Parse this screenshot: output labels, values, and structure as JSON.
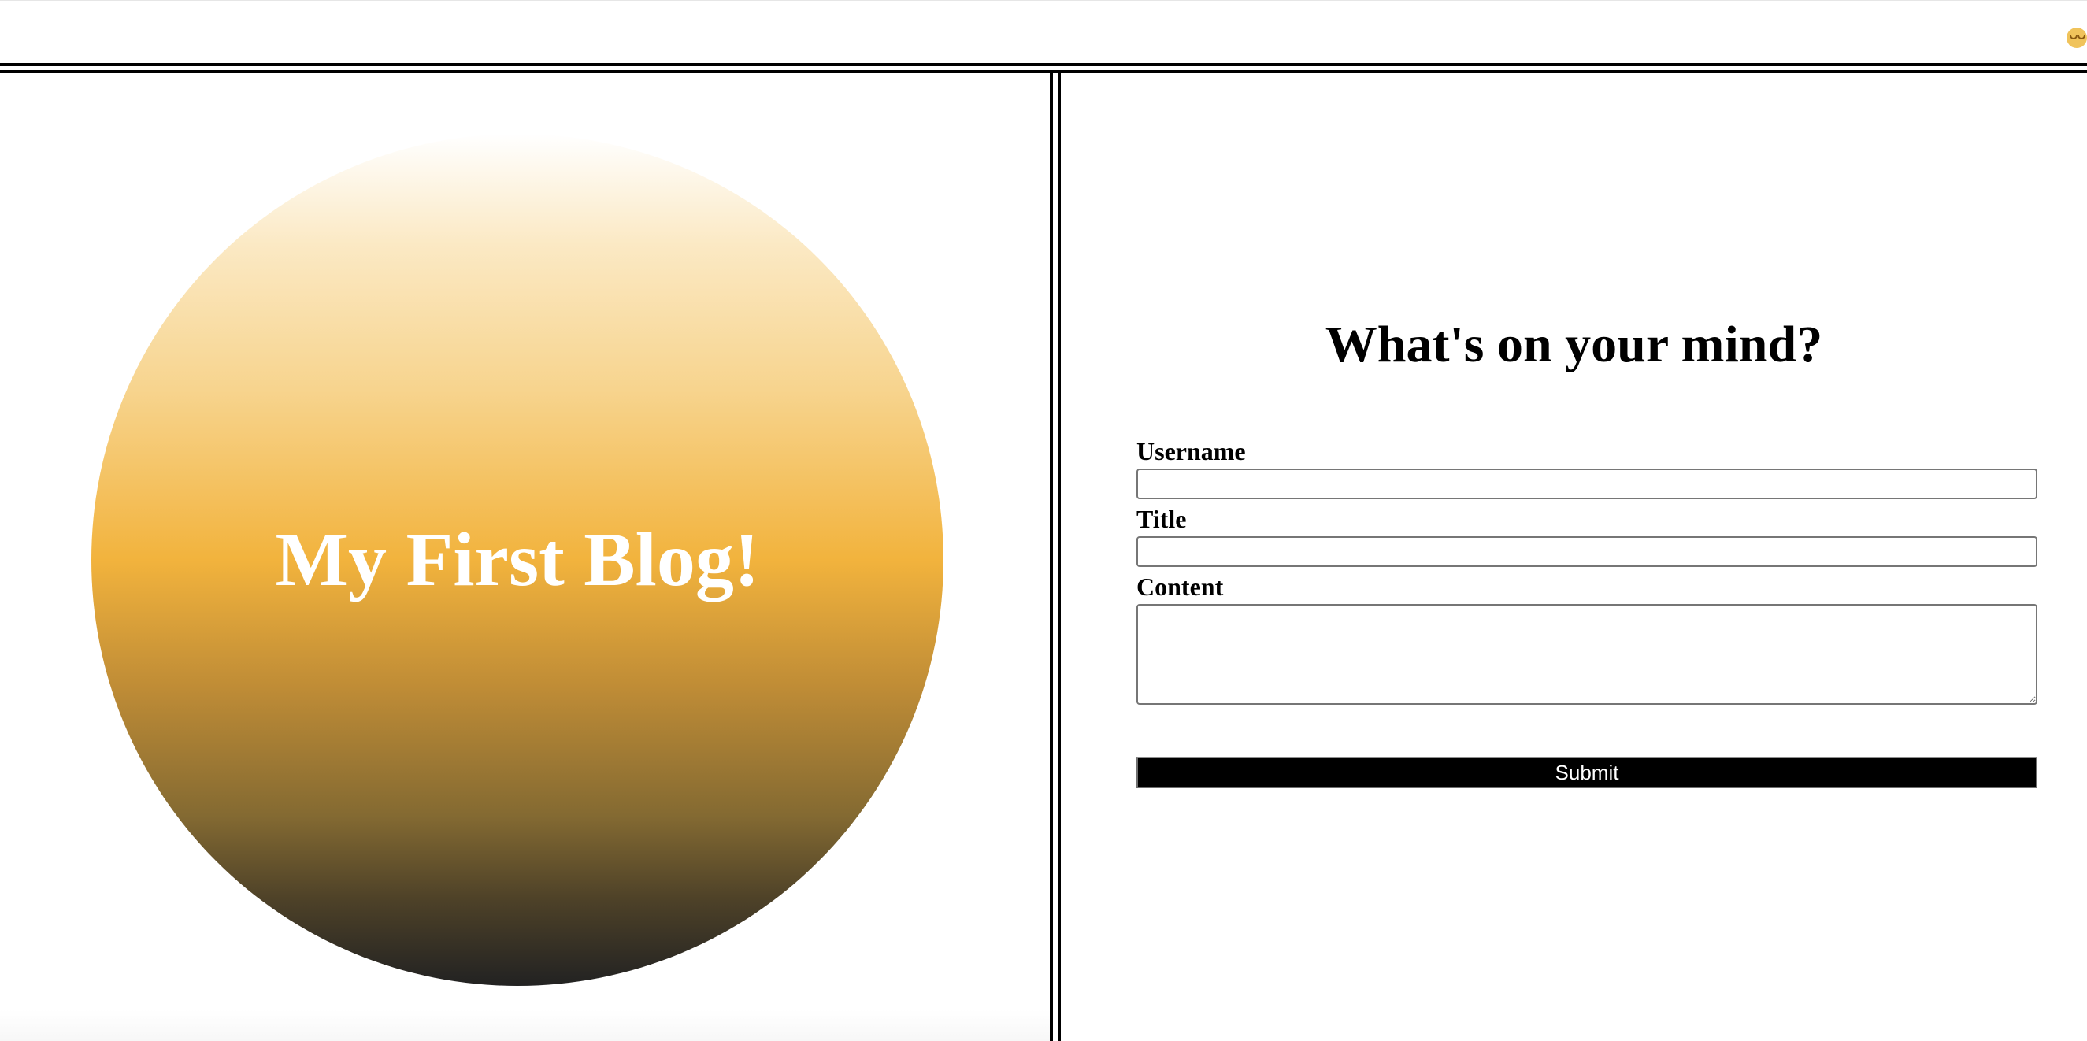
{
  "header": {
    "theme_toggle_icon": "smiley-face-icon"
  },
  "hero": {
    "title": "My First Blog!",
    "gradient_colors": [
      "#ffffff",
      "#f7d48e",
      "#f2b33d",
      "#846a32",
      "#222222"
    ]
  },
  "form": {
    "heading": "What's on your mind?",
    "username_label": "Username",
    "username_value": "",
    "title_label": "Title",
    "title_value": "",
    "content_label": "Content",
    "content_value": "",
    "submit_label": "Submit"
  },
  "colors": {
    "accent": "#f2b33d",
    "dark": "#222222",
    "button_bg": "#000000",
    "button_text": "#ffffff"
  }
}
